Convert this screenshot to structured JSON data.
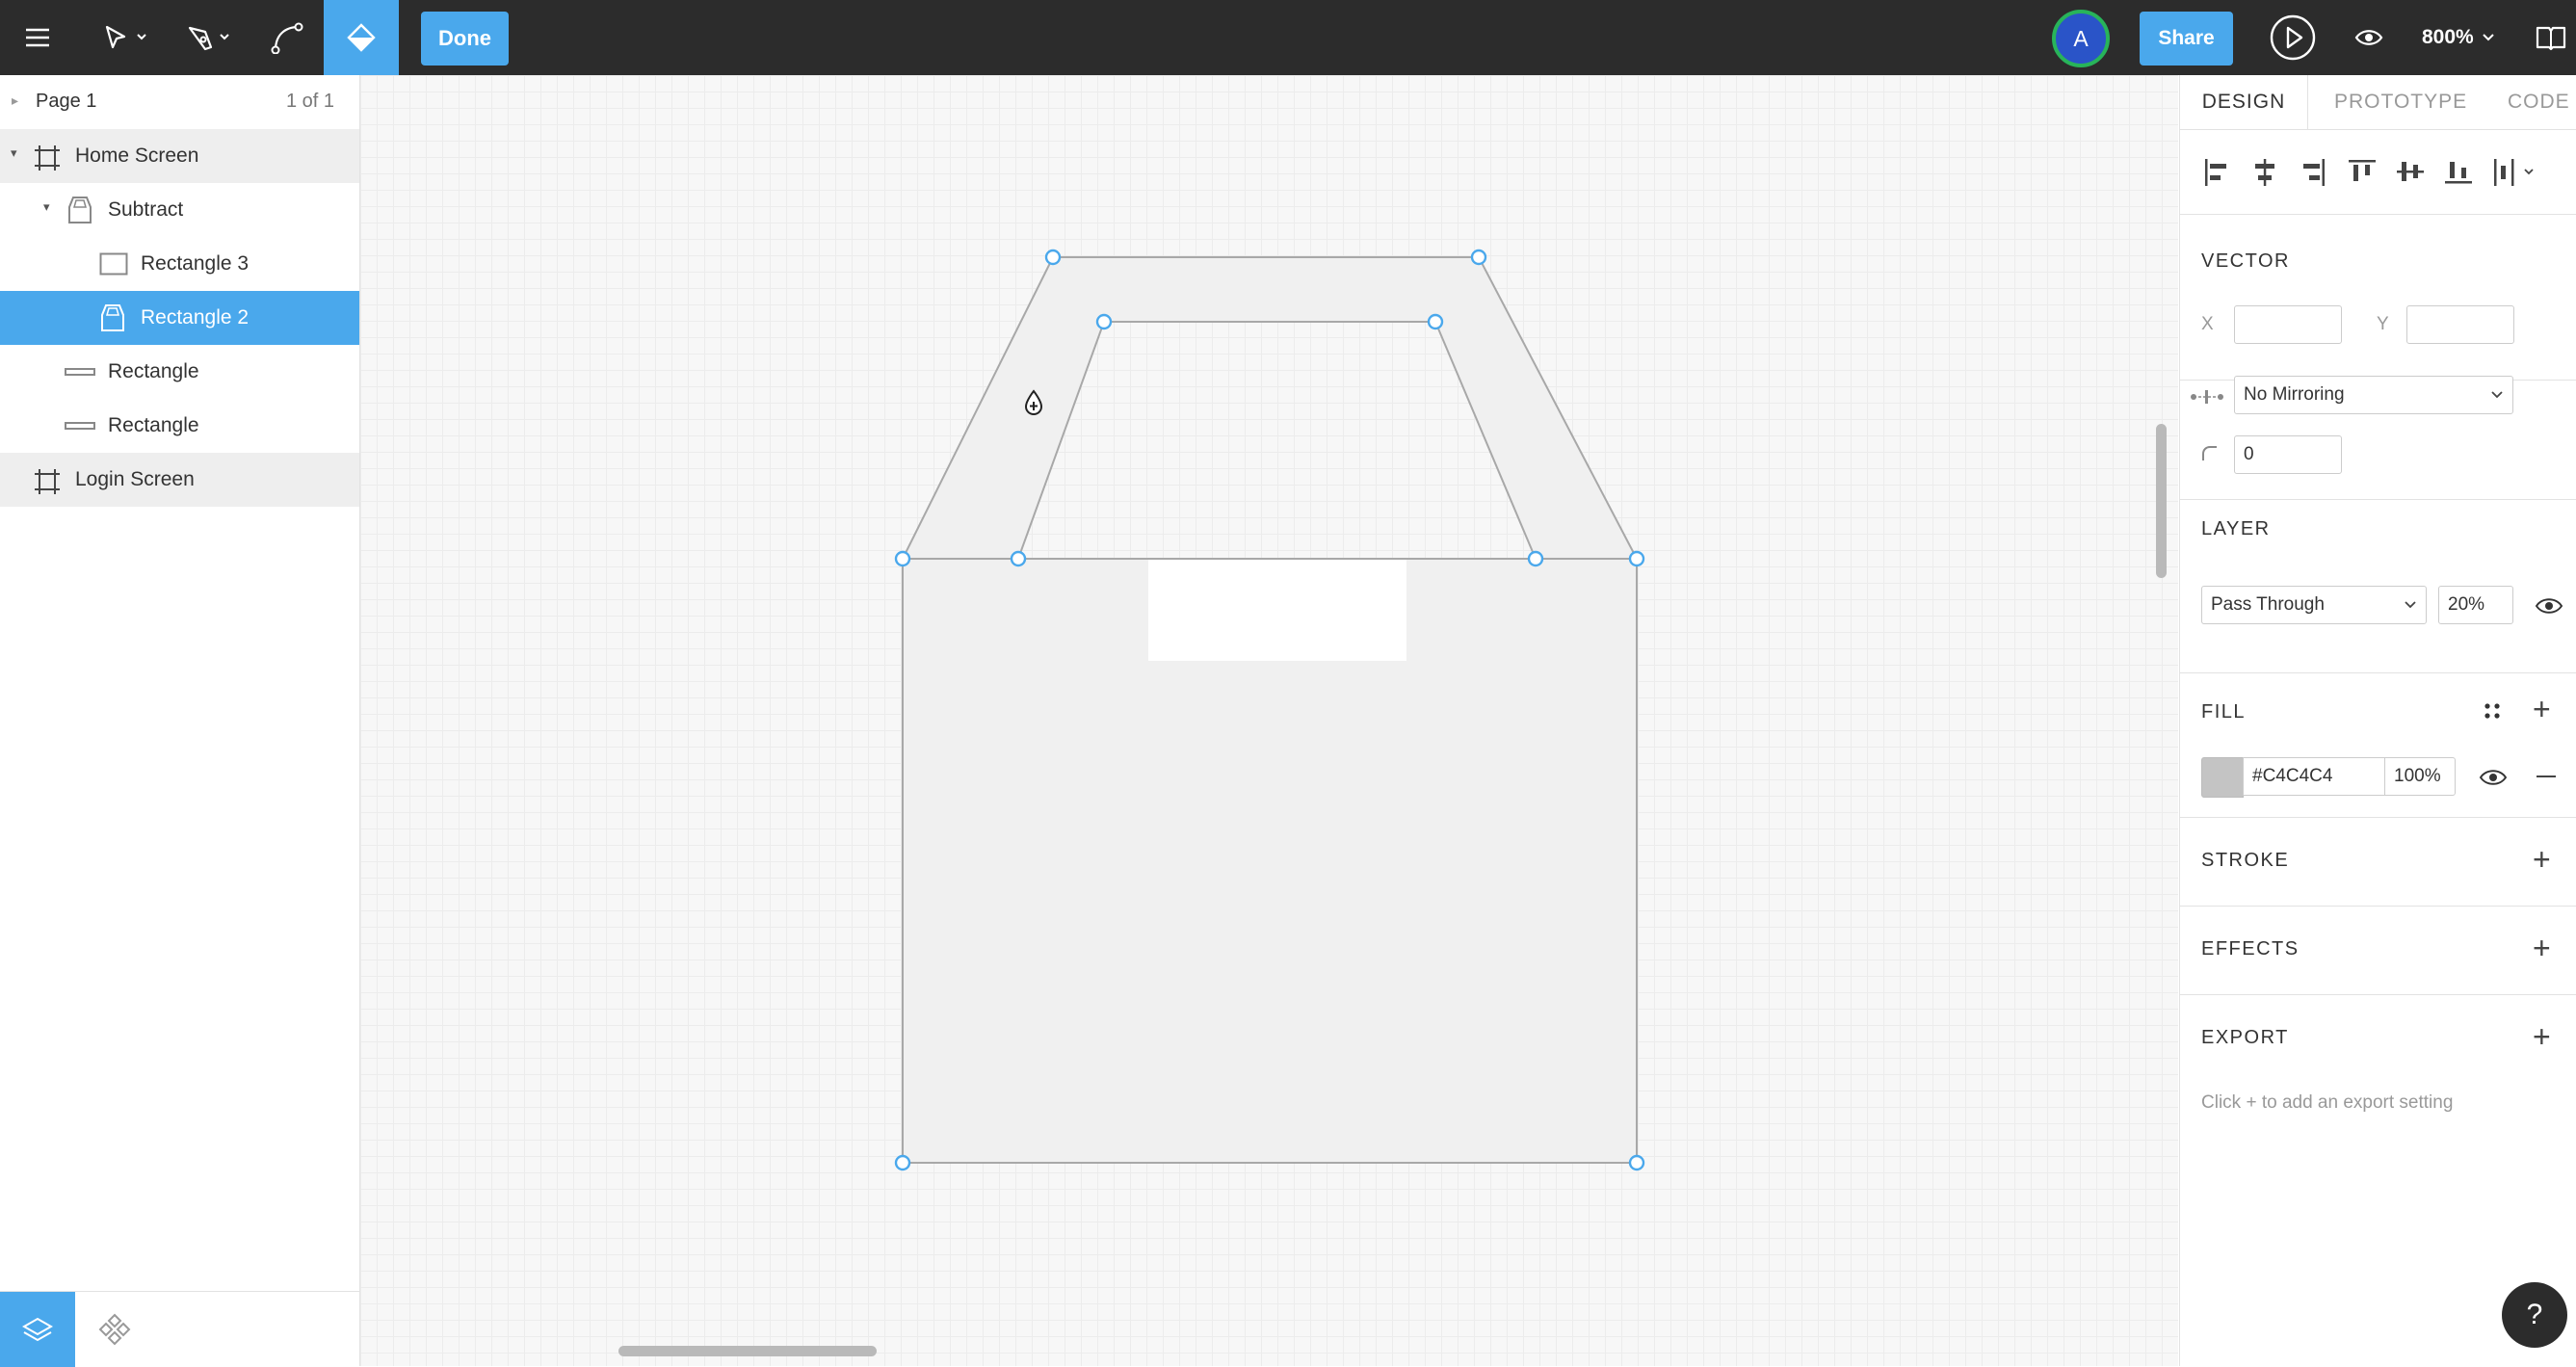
{
  "toolbar": {
    "menu_icon": "hamburger-icon",
    "tools": [
      "move-tool-icon",
      "pen-tool-icon",
      "pencil-tool-icon",
      "paint-bucket-icon"
    ],
    "done_label": "Done",
    "avatar_initial": "A",
    "share_label": "Share",
    "zoom_label": "800%"
  },
  "pages": {
    "current": "Page 1",
    "count": "1 of 1"
  },
  "layers": [
    {
      "label": "Home Screen",
      "icon": "frame-icon",
      "state": "frame"
    },
    {
      "label": "Subtract",
      "icon": "boolean-subtract-icon",
      "state": "normal"
    },
    {
      "label": "Rectangle 3",
      "icon": "rectangle-icon",
      "state": "normal"
    },
    {
      "label": "Rectangle 2",
      "icon": "boolean-subtract-icon",
      "state": "selected"
    },
    {
      "label": "Rectangle",
      "icon": "line-rectangle-icon",
      "state": "normal"
    },
    {
      "label": "Rectangle",
      "icon": "line-rectangle-icon",
      "state": "normal"
    },
    {
      "label": "Login Screen",
      "icon": "frame-icon",
      "state": "frame"
    }
  ],
  "right_panel": {
    "tabs": [
      "DESIGN",
      "PROTOTYPE",
      "CODE"
    ],
    "active_tab": "DESIGN",
    "vector": {
      "title": "VECTOR",
      "x_label": "X",
      "y_label": "Y",
      "x_value": "",
      "y_value": "",
      "mirroring": "No Mirroring",
      "corner_radius": "0"
    },
    "layer": {
      "title": "LAYER",
      "blend_mode": "Pass Through",
      "opacity": "20%"
    },
    "fill": {
      "title": "FILL",
      "color_hex": "#C4C4C4",
      "opacity": "100%"
    },
    "stroke_title": "STROKE",
    "effects_title": "EFFECTS",
    "export": {
      "title": "EXPORT",
      "hint": "Click + to add an export setting"
    }
  },
  "help_label": "?",
  "colors": {
    "accent": "#4aa8ec",
    "toolbar_bg": "#2c2c2c",
    "shape_fill": "#f0f0f0",
    "handle": "#4aa8ec"
  }
}
